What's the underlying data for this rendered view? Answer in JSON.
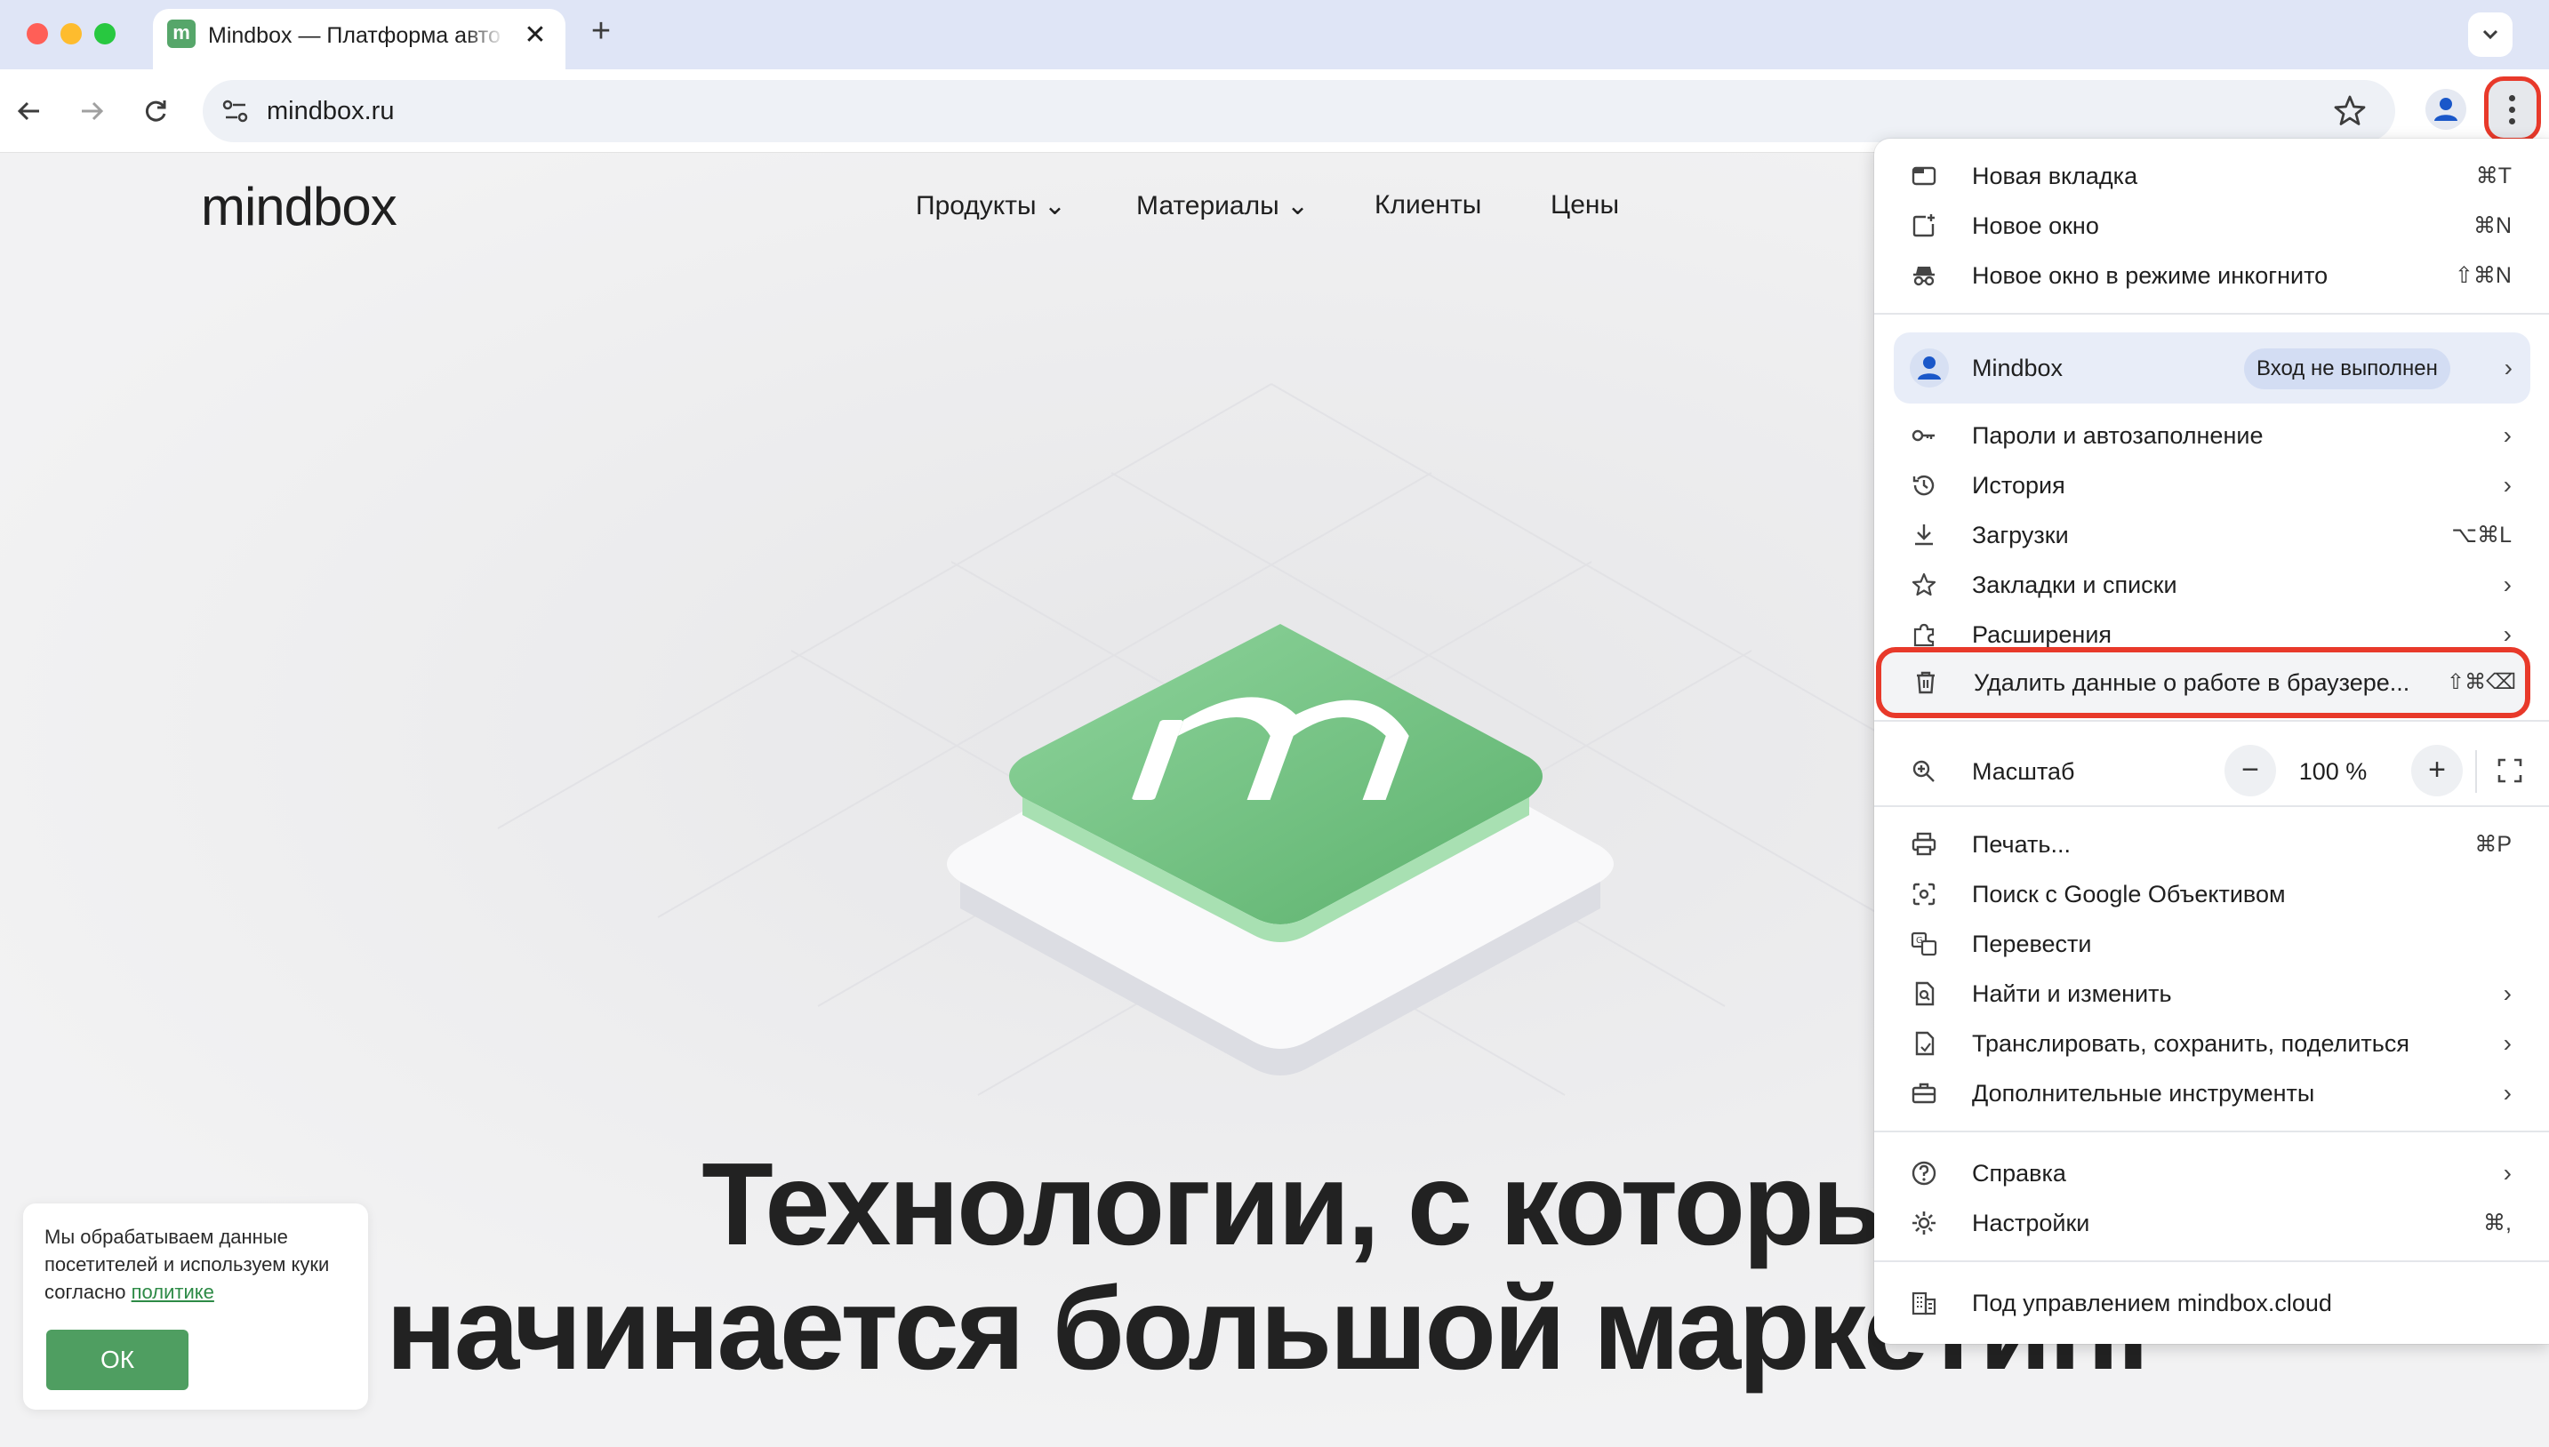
{
  "browser": {
    "tab": {
      "favicon_letter": "m",
      "title": "Mindbox — Платформа автом",
      "close_glyph": "✕"
    },
    "new_tab_glyph": "+",
    "url": "mindbox.ru"
  },
  "site": {
    "logo": "mindbox",
    "nav": [
      {
        "label": "Продукты ⌄"
      },
      {
        "label": "Материалы ⌄"
      },
      {
        "label": "Клиенты"
      },
      {
        "label": "Цены"
      }
    ],
    "hero": {
      "line1": "Технологии, с которых",
      "line2": "начинается большой маркетинг"
    },
    "cookie": {
      "text": "Мы обрабатываем данные посетителей и используем куки согласно",
      "link": "политике",
      "ok": "ОК"
    }
  },
  "menu": {
    "items": [
      {
        "label": "Новая вкладка",
        "shortcut": "⌘T"
      },
      {
        "label": "Новое окно",
        "shortcut": "⌘N"
      },
      {
        "label": "Новое окно в режиме инкогнито",
        "shortcut": "⇧⌘N"
      },
      {
        "label": "Пароли и автозаполнение"
      },
      {
        "label": "История"
      },
      {
        "label": "Загрузки",
        "shortcut": "⌥⌘L"
      },
      {
        "label": "Закладки и списки"
      },
      {
        "label": "Расширения"
      },
      {
        "label": "Удалить данные о работе в браузере...",
        "shortcut": "⇧⌘⌫"
      },
      {
        "label": "Масштаб"
      },
      {
        "label": "Печать...",
        "shortcut": "⌘P"
      },
      {
        "label": "Поиск с Google Объективом"
      },
      {
        "label": "Перевести"
      },
      {
        "label": "Найти и изменить"
      },
      {
        "label": "Транслировать, сохранить, поделиться"
      },
      {
        "label": "Дополнительные инструменты"
      },
      {
        "label": "Справка"
      },
      {
        "label": "Настройки",
        "shortcut": "⌘,"
      },
      {
        "label": "Под управлением mindbox.cloud"
      }
    ],
    "profile": {
      "name": "Mindbox",
      "status": "Вход не выполнен"
    },
    "zoom": {
      "minus": "−",
      "value": "100 %",
      "plus": "+"
    },
    "chevron": "›"
  },
  "colors": {
    "accent_green": "#4f9e61",
    "highlight_red": "#e8392a",
    "tabstrip": "#dfe5f6"
  }
}
